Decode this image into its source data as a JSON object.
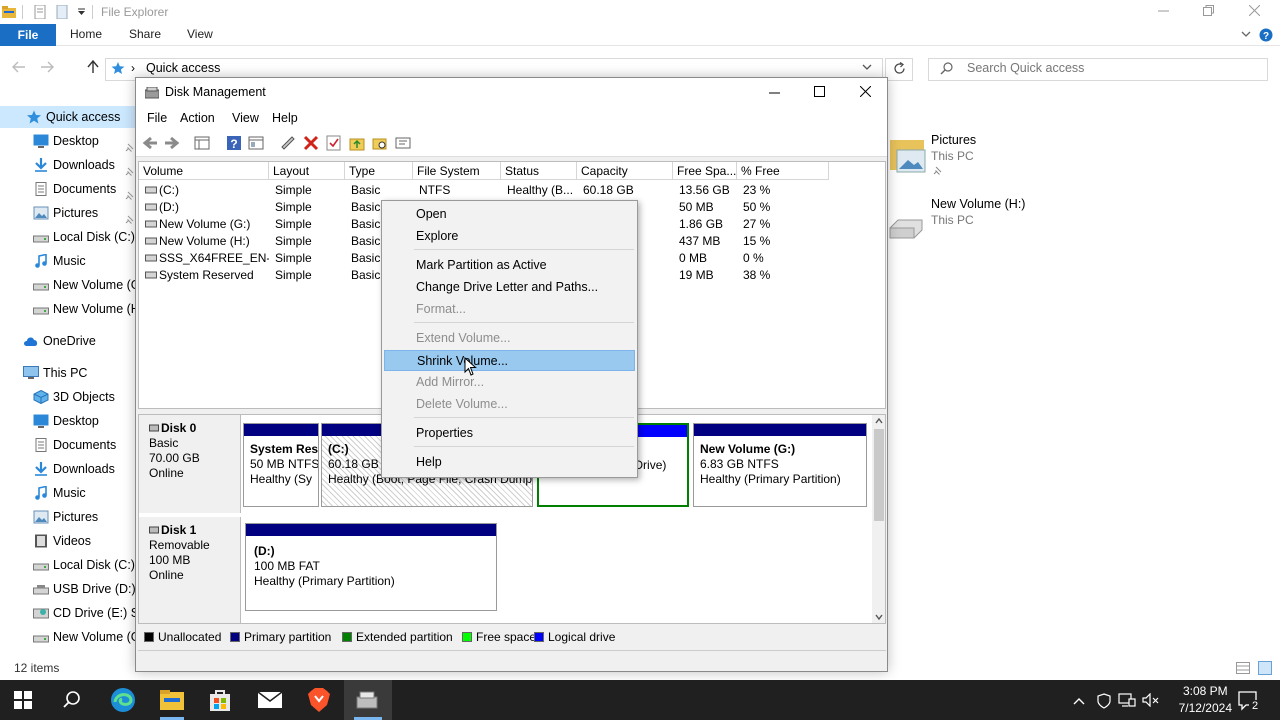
{
  "explorer": {
    "title": "File Explorer",
    "tabs": {
      "file": "File",
      "home": "Home",
      "share": "Share",
      "view": "View"
    },
    "address": "Quick access",
    "search_placeholder": "Search Quick access",
    "nav": [
      {
        "label": "Quick access",
        "icon": "star-icon"
      },
      {
        "label": "Desktop",
        "icon": "desktop-icon"
      },
      {
        "label": "Downloads",
        "icon": "download-icon"
      },
      {
        "label": "Documents",
        "icon": "documents-icon"
      },
      {
        "label": "Pictures",
        "icon": "pictures-icon"
      },
      {
        "label": "Local Disk (C:)",
        "icon": "drive-icon"
      },
      {
        "label": "Music",
        "icon": "music-icon"
      },
      {
        "label": "New Volume (G:)",
        "icon": "drive-icon"
      },
      {
        "label": "New Volume (H:)",
        "icon": "drive-icon"
      },
      {
        "label": "OneDrive",
        "icon": "cloud-icon"
      },
      {
        "label": "This PC",
        "icon": "pc-icon"
      },
      {
        "label": "3D Objects",
        "icon": "cube-icon"
      },
      {
        "label": "Desktop",
        "icon": "desktop-icon"
      },
      {
        "label": "Documents",
        "icon": "documents-icon"
      },
      {
        "label": "Downloads",
        "icon": "download-icon"
      },
      {
        "label": "Music",
        "icon": "music-icon"
      },
      {
        "label": "Pictures",
        "icon": "pictures-icon"
      },
      {
        "label": "Videos",
        "icon": "videos-icon"
      },
      {
        "label": "Local Disk (C:)",
        "icon": "drive-icon"
      },
      {
        "label": "USB Drive (D:)",
        "icon": "usb-icon"
      },
      {
        "label": "CD Drive (E:) SSS",
        "icon": "cd-icon"
      },
      {
        "label": "New Volume (G:)",
        "icon": "drive-icon"
      }
    ],
    "status": "12 items",
    "right_items": [
      {
        "name": "Pictures",
        "sub": "This PC"
      },
      {
        "name": "New Volume (H:)",
        "sub": "This PC"
      }
    ]
  },
  "disk_mgmt": {
    "title": "Disk Management",
    "menu": [
      "File",
      "Action",
      "View",
      "Help"
    ],
    "columns": [
      "Volume",
      "Layout",
      "Type",
      "File System",
      "Status",
      "Capacity",
      "Free Spa...",
      "% Free"
    ],
    "rows": [
      [
        "(C:)",
        "Simple",
        "Basic",
        "NTFS",
        "Healthy (B...",
        "60.18 GB",
        "13.56 GB",
        "23 %"
      ],
      [
        "(D:)",
        "Simple",
        "Basic",
        "",
        "",
        "",
        "50 MB",
        "50 %"
      ],
      [
        "New Volume (G:)",
        "Simple",
        "Basic",
        "",
        "",
        "",
        "1.86 GB",
        "27 %"
      ],
      [
        "New Volume (H:)",
        "Simple",
        "Basic",
        "",
        "",
        "",
        "437 MB",
        "15 %"
      ],
      [
        "SSS_X64FREE_EN-...",
        "Simple",
        "Basic",
        "",
        "",
        "",
        "0 MB",
        "0 %"
      ],
      [
        "System Reserved",
        "Simple",
        "Basic",
        "",
        "",
        "",
        "19 MB",
        "38 %"
      ]
    ],
    "disks": [
      {
        "name": "Disk 0",
        "type": "Basic",
        "size": "70.00 GB",
        "state": "Online",
        "parts": [
          {
            "title": "System Res",
            "line1": "50 MB NTFS",
            "line2": "Healthy (Sy"
          },
          {
            "title": "(C:)",
            "line1": "60.18 GB N",
            "line2": "Healthy (Boot, Page File, Crash Dump,"
          },
          {
            "title": ":)",
            "line1": "",
            "line2": "Healthy (Logical Drive)"
          },
          {
            "title": "New Volume  (G:)",
            "line1": "6.83 GB NTFS",
            "line2": "Healthy (Primary Partition)"
          }
        ]
      },
      {
        "name": "Disk 1",
        "type": "Removable",
        "size": "100 MB",
        "state": "Online",
        "parts": [
          {
            "title": "(D:)",
            "line1": "100 MB FAT",
            "line2": "Healthy (Primary Partition)"
          }
        ]
      }
    ],
    "legend": [
      {
        "label": "Unallocated",
        "color": "#000000"
      },
      {
        "label": "Primary partition",
        "color": "#000080"
      },
      {
        "label": "Extended partition",
        "color": "#008000"
      },
      {
        "label": "Free space",
        "color": "#00ff00"
      },
      {
        "label": "Logical drive",
        "color": "#0000ff"
      }
    ]
  },
  "context_menu": {
    "items": [
      {
        "label": "Open",
        "disabled": false
      },
      {
        "label": "Explore",
        "disabled": false
      },
      {
        "label": "Mark Partition as Active",
        "disabled": false
      },
      {
        "label": "Change Drive Letter and Paths...",
        "disabled": false
      },
      {
        "label": "Format...",
        "disabled": true
      },
      {
        "label": "Extend Volume...",
        "disabled": true
      },
      {
        "label": "Shrink Volume...",
        "disabled": false,
        "highlighted": true
      },
      {
        "label": "Add Mirror...",
        "disabled": true
      },
      {
        "label": "Delete Volume...",
        "disabled": true
      },
      {
        "label": "Properties",
        "disabled": false
      },
      {
        "label": "Help",
        "disabled": false
      }
    ]
  },
  "taskbar": {
    "time": "3:08 PM",
    "date": "7/12/2024",
    "notifications": "2"
  }
}
